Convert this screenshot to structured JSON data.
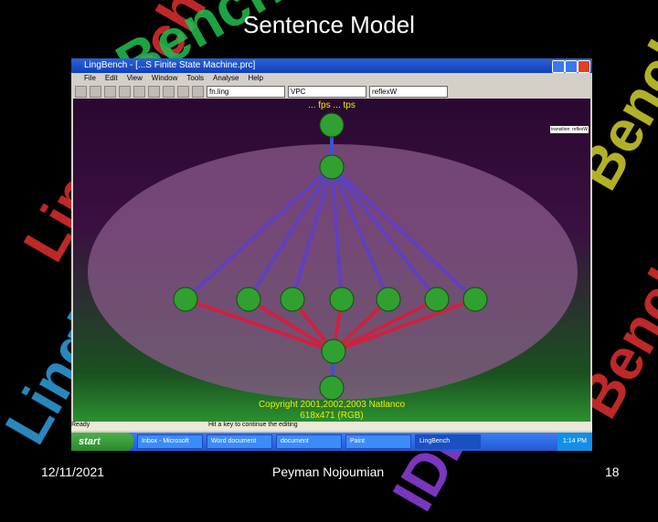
{
  "slide": {
    "title": "Sentence Model",
    "date": "12/11/2021",
    "author": "Peyman Nojoumian",
    "page": "18"
  },
  "watermark": [
    "LingBench IDE",
    "LingBench IDE",
    "LingBench IDE",
    "LingBench IDE"
  ],
  "window": {
    "title": "LingBench - [...S Finite State Machine.prc]",
    "menu": [
      "File",
      "Edit",
      "View",
      "Window",
      "Tools",
      "Analyse",
      "Help"
    ],
    "file_field": "fn.ling",
    "combo1": "VPC",
    "combo2": "reflexW",
    "fps": "... fps ... tps",
    "side_label": "transition: reflexW",
    "copyright": "Copyright 2001,2002,2003 Natlanco",
    "resolution": "618x471 (RGB)",
    "status_left": "Ready",
    "status_right": "Hit a key to continue the editing"
  },
  "taskbar": {
    "start": "start",
    "items": [
      "Inbox - Microsoft",
      "Word document",
      "document",
      "Paint",
      "LingBench"
    ],
    "clock": "1:14 PM"
  }
}
